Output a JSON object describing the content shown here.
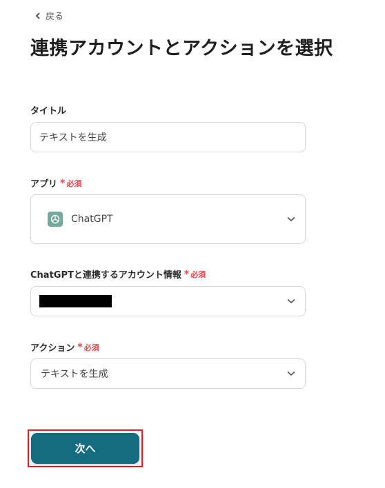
{
  "nav": {
    "back_label": "戻る"
  },
  "page": {
    "title": "連携アカウントとアクションを選択"
  },
  "required_label": "必須",
  "fields": {
    "title": {
      "label": "タイトル",
      "value": "テキストを生成"
    },
    "app": {
      "label": "アプリ",
      "value": "ChatGPT",
      "icon": "chatgpt-logo-icon"
    },
    "account": {
      "label": "ChatGPTと連携するアカウント情報",
      "value_redacted": true
    },
    "action": {
      "label": "アクション",
      "value": "テキストを生成"
    }
  },
  "buttons": {
    "next_label": "次へ"
  },
  "colors": {
    "primary": "#156b80",
    "required": "#e5484d",
    "highlight": "#e0202a",
    "chatgpt": "#74aa9c"
  }
}
